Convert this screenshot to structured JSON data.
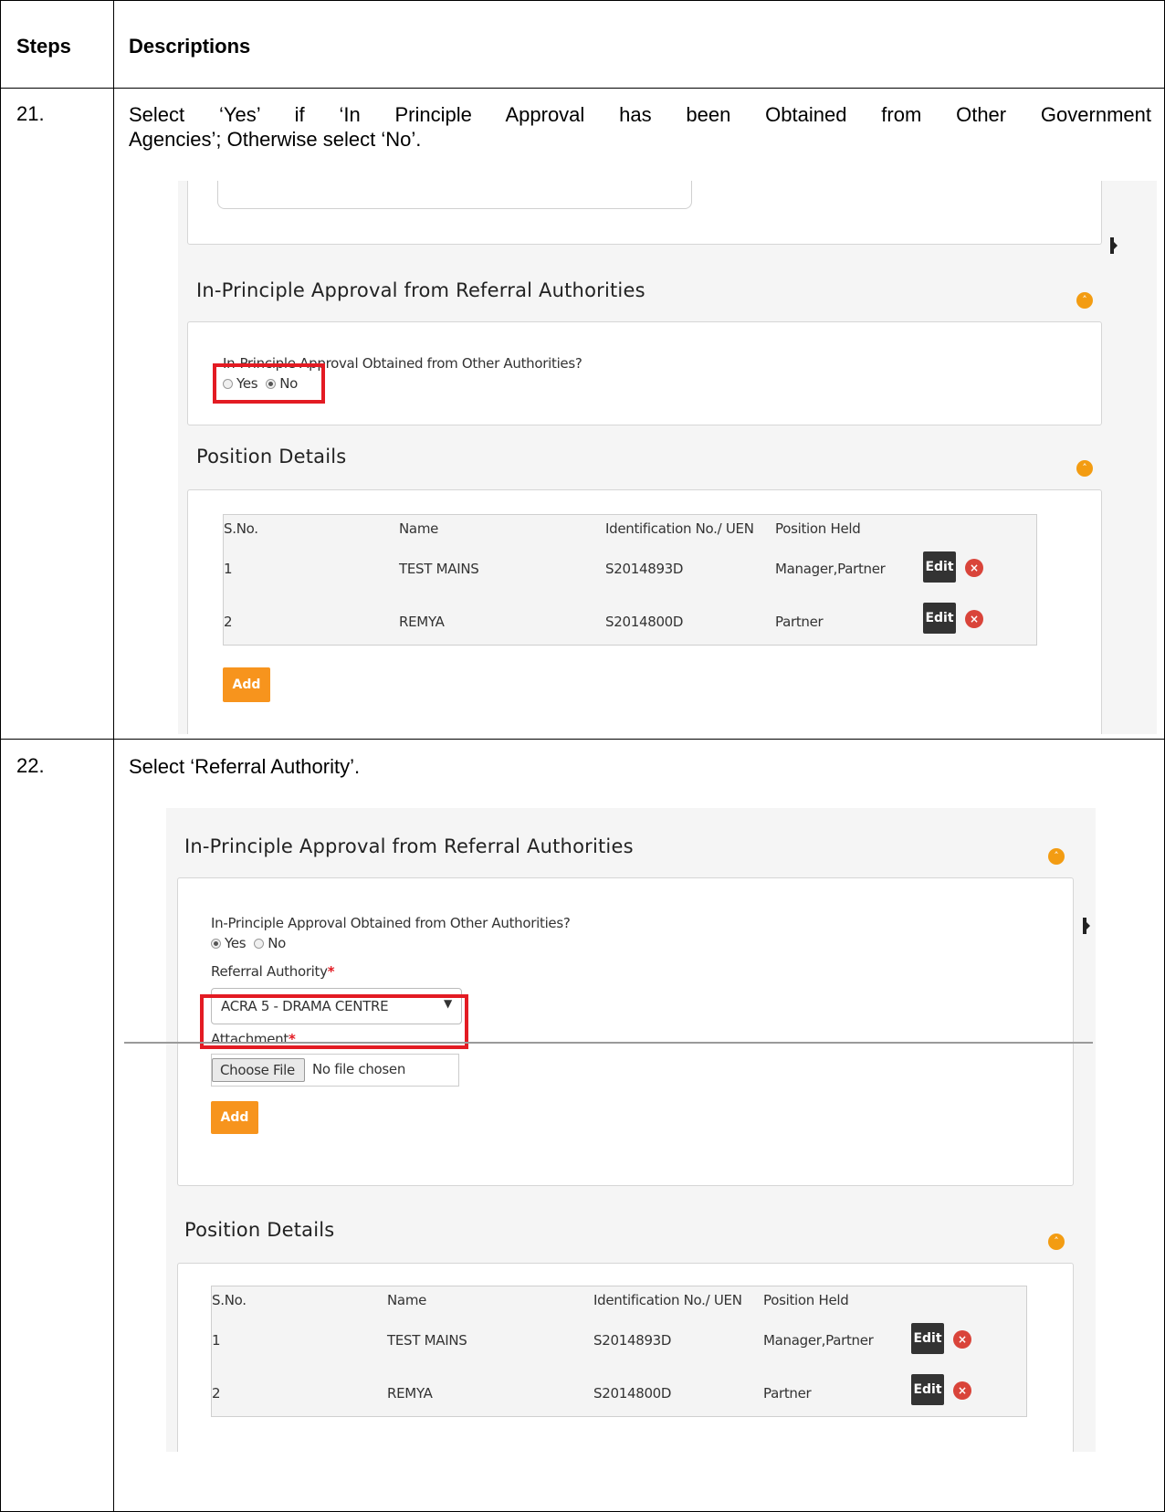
{
  "table": {
    "col_steps": "Steps",
    "col_descriptions": "Descriptions"
  },
  "step21": {
    "number": "21.",
    "text_line1": "Select ‘Yes’ if ‘In Principle Approval has been Obtained from Other Government",
    "text_line2": "Agencies’; Otherwise select ‘No’."
  },
  "step22": {
    "number": "22.",
    "text": "Select ‘Referral Authority’."
  },
  "shot1": {
    "section_title": "In-Principle Approval from Referral Authorities",
    "question": "In-Principle Approval Obtained from Other Authorities?",
    "yes_label": "Yes",
    "no_label": "No",
    "selected": "No",
    "position_title": "Position Details",
    "headers": [
      "S.No.",
      "Name",
      "Identification No./ UEN",
      "Position Held"
    ],
    "rows": [
      {
        "sno": "1",
        "name": "TEST MAINS",
        "id": "S2014893D",
        "position": "Manager,Partner"
      },
      {
        "sno": "2",
        "name": "REMYA",
        "id": "S2014800D",
        "position": "Partner"
      }
    ],
    "edit_label": "Edit",
    "add_label": "Add"
  },
  "shot2": {
    "section_title": "In-Principle Approval from Referral Authorities",
    "question": "In-Principle Approval Obtained from Other Authorities?",
    "yes_label": "Yes",
    "no_label": "No",
    "selected": "Yes",
    "referral_label": "Referral Authority",
    "referral_value": "ACRA 5 - DRAMA CENTRE",
    "attachment_label": "Attachment",
    "choose_file": "Choose File",
    "no_file": "No file chosen",
    "add_label": "Add",
    "position_title": "Position Details",
    "headers": [
      "S.No.",
      "Name",
      "Identification No./ UEN",
      "Position Held"
    ],
    "rows": [
      {
        "sno": "1",
        "name": "TEST MAINS",
        "id": "S2014893D",
        "position": "Manager,Partner"
      },
      {
        "sno": "2",
        "name": "REMYA",
        "id": "S2014800D",
        "position": "Partner"
      }
    ],
    "edit_label": "Edit"
  },
  "colors": {
    "highlight": "#e31b23",
    "accent_orange": "#f7941d",
    "edit_dark": "#333333",
    "delete_red": "#d9443a"
  }
}
